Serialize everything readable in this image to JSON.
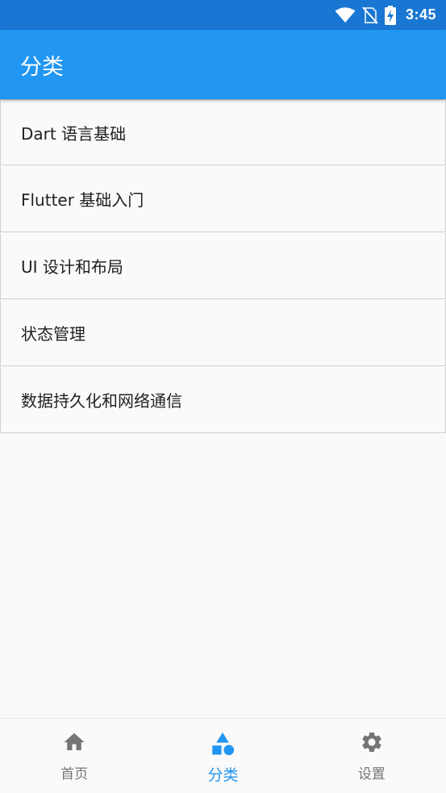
{
  "status_bar": {
    "time": "3:45",
    "icons": [
      "wifi-icon",
      "no-sim-icon",
      "battery-charging-icon"
    ],
    "color": "#1976d2"
  },
  "app_bar": {
    "title": "分类",
    "color": "#2196f3"
  },
  "categories": [
    {
      "label": "Dart 语言基础"
    },
    {
      "label": "Flutter 基础入门"
    },
    {
      "label": "UI 设计和布局"
    },
    {
      "label": "状态管理"
    },
    {
      "label": "数据持久化和网络通信"
    }
  ],
  "bottom_nav": {
    "active_color": "#2196f3",
    "inactive_color": "#757575",
    "items": [
      {
        "label": "首页",
        "icon": "home-icon",
        "active": false
      },
      {
        "label": "分类",
        "icon": "category-icon",
        "active": true
      },
      {
        "label": "设置",
        "icon": "settings-icon",
        "active": false
      }
    ]
  }
}
